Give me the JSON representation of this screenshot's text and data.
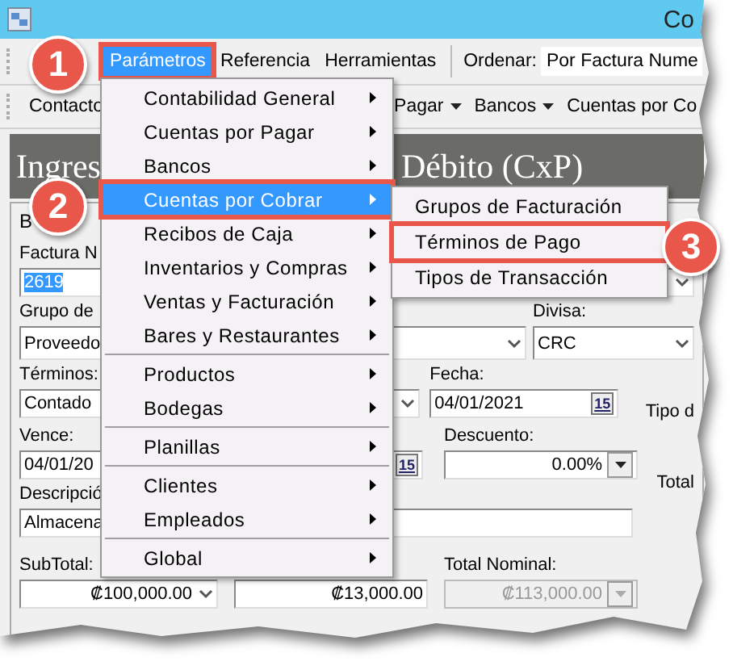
{
  "window": {
    "title": "Co"
  },
  "menu_bar": {
    "items": [
      {
        "label": "Parámetros",
        "selected": true,
        "outlined": true
      },
      {
        "label": "Referencia",
        "selected": false,
        "outlined": false
      },
      {
        "label": "Herramientas",
        "selected": false,
        "outlined": false
      }
    ],
    "sort_label": "Ordenar:",
    "sort_value": "Por Factura Nume"
  },
  "toolbar": {
    "items": [
      {
        "label": "Contacto",
        "dropdown": false
      },
      {
        "label": "Pagar",
        "dropdown": true
      },
      {
        "label": "Bancos",
        "dropdown": true
      },
      {
        "label": "Cuentas por Co",
        "dropdown": false
      }
    ]
  },
  "header": {
    "left": "Ingres",
    "right": "Débito (CxP)"
  },
  "form": {
    "tab_label": "B",
    "invoice_number": {
      "label": "Factura N",
      "value": "2619",
      "selected": true
    },
    "group": {
      "label": "Grupo de",
      "value": "Proveedo"
    },
    "currency": {
      "label": "Divisa:",
      "value": "CRC"
    },
    "terms": {
      "label": "Términos:",
      "value": "Contado"
    },
    "date": {
      "label": "Fecha:",
      "value": "04/01/2021",
      "button": "15"
    },
    "due": {
      "label": "Vence:",
      "value": "04/01/20",
      "button": "15"
    },
    "discount": {
      "label": "Descuento:",
      "value": "0.00%"
    },
    "description": {
      "label": "Descripció",
      "value": "Almacena"
    },
    "subtotal": {
      "label": "SubTotal:",
      "value": "₡100,000.00"
    },
    "tax": {
      "value": "₡13,000.00"
    },
    "total_nominal": {
      "label": "Total Nominal:",
      "value": "₡113,000.00",
      "disabled": true
    },
    "side_labels": [
      "Tipo d",
      "Total"
    ]
  },
  "menu": {
    "items": [
      {
        "label": "Contabilidad General",
        "submenu": true,
        "selected": false,
        "outlined": false,
        "separator_before": false
      },
      {
        "label": "Cuentas por Pagar",
        "submenu": true,
        "selected": false,
        "outlined": false,
        "separator_before": false
      },
      {
        "label": "Bancos",
        "submenu": true,
        "selected": false,
        "outlined": false,
        "separator_before": false
      },
      {
        "label": "Cuentas por Cobrar",
        "submenu": true,
        "selected": true,
        "outlined": true,
        "separator_before": false
      },
      {
        "label": "Recibos de Caja",
        "submenu": true,
        "selected": false,
        "outlined": false,
        "separator_before": false
      },
      {
        "label": "Inventarios y Compras",
        "submenu": true,
        "selected": false,
        "outlined": false,
        "separator_before": false
      },
      {
        "label": "Ventas y Facturación",
        "submenu": true,
        "selected": false,
        "outlined": false,
        "separator_before": false
      },
      {
        "label": "Bares y Restaurantes",
        "submenu": true,
        "selected": false,
        "outlined": false,
        "separator_before": false
      },
      {
        "label": "Productos",
        "submenu": true,
        "selected": false,
        "outlined": false,
        "separator_before": true
      },
      {
        "label": "Bodegas",
        "submenu": true,
        "selected": false,
        "outlined": false,
        "separator_before": false
      },
      {
        "label": "Planillas",
        "submenu": true,
        "selected": false,
        "outlined": false,
        "separator_before": true
      },
      {
        "label": "Clientes",
        "submenu": true,
        "selected": false,
        "outlined": false,
        "separator_before": true
      },
      {
        "label": "Empleados",
        "submenu": true,
        "selected": false,
        "outlined": false,
        "separator_before": false
      },
      {
        "label": "Global",
        "submenu": true,
        "selected": false,
        "outlined": false,
        "separator_before": true
      }
    ]
  },
  "submenu": {
    "items": [
      {
        "label": "Grupos de Facturación",
        "selected": false,
        "outlined": false
      },
      {
        "label": "Términos de Pago",
        "selected": false,
        "outlined": true
      },
      {
        "label": "Tipos de Transacción",
        "selected": false,
        "outlined": false
      }
    ]
  },
  "callouts": [
    {
      "label": "1"
    },
    {
      "label": "2"
    },
    {
      "label": "3"
    }
  ]
}
